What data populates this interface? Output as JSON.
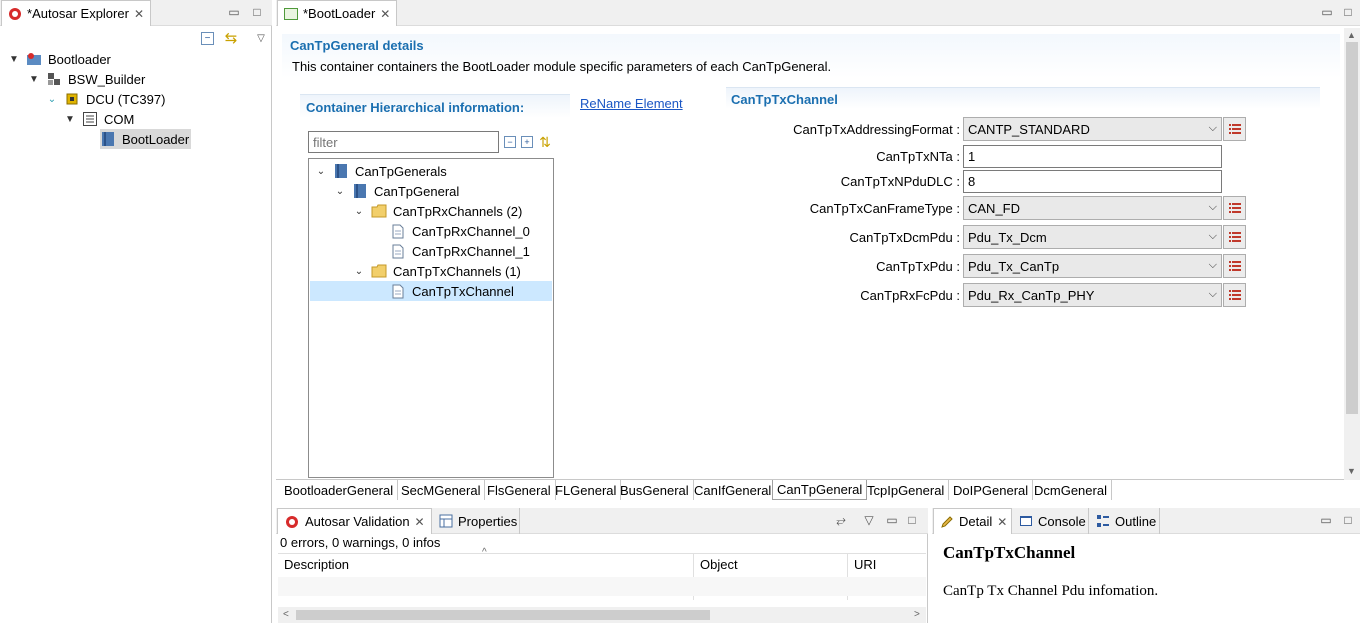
{
  "explorer": {
    "tab_title": "*Autosar Explorer",
    "tree": [
      {
        "label": "Bootloader",
        "icon": "autosar-project-icon"
      },
      {
        "label": "BSW_Builder",
        "icon": "builder-icon"
      },
      {
        "label": "DCU (TC397)",
        "icon": "chip-icon"
      },
      {
        "label": "COM",
        "icon": "list-icon"
      },
      {
        "label": "BootLoader",
        "icon": "module-icon"
      }
    ]
  },
  "editor": {
    "tab_title": "*BootLoader",
    "details_title": "CanTpGeneral details",
    "details_desc": "This container containers the BootLoader module specific parameters of each CanTpGeneral.",
    "hier_title": "Container Hierarchical information:",
    "rename_link": "ReName Element",
    "filter_placeholder": "filter",
    "tree": [
      {
        "label": "CanTpGenerals"
      },
      {
        "label": "CanTpGeneral"
      },
      {
        "label": "CanTpRxChannels (2)"
      },
      {
        "label": "CanTpRxChannel_0"
      },
      {
        "label": "CanTpRxChannel_1"
      },
      {
        "label": "CanTpTxChannels (1)"
      },
      {
        "label": "CanTpTxChannel"
      }
    ],
    "form_title": "CanTpTxChannel",
    "fields": [
      {
        "label": "CanTpTxAddressingFormat :",
        "value": "CANTP_STANDARD",
        "kind": "combo"
      },
      {
        "label": "CanTpTxNTa :",
        "value": "1",
        "kind": "text"
      },
      {
        "label": "CanTpTxNPduDLC :",
        "value": "8",
        "kind": "text"
      },
      {
        "label": "CanTpTxCanFrameType :",
        "value": "CAN_FD",
        "kind": "combo"
      },
      {
        "label": "CanTpTxDcmPdu :",
        "value": "Pdu_Tx_Dcm",
        "kind": "combo"
      },
      {
        "label": "CanTpTxPdu :",
        "value": "Pdu_Tx_CanTp",
        "kind": "combo"
      },
      {
        "label": "CanTpRxFcPdu :",
        "value": "Pdu_Rx_CanTp_PHY",
        "kind": "combo"
      }
    ],
    "bottom_tabs": [
      "BootloaderGeneral",
      "SecMGeneral",
      "FlsGeneral",
      "FLGeneral",
      "BusGeneral",
      "CanIfGeneral",
      "CanTpGeneral",
      "TcpIpGeneral",
      "DoIPGeneral",
      "DcmGeneral"
    ],
    "active_bottom_tab": "CanTpGeneral"
  },
  "validation": {
    "tab_title": "Autosar Validation",
    "properties_tab": "Properties",
    "summary": "0 errors, 0 warnings, 0 infos",
    "columns": [
      "Description",
      "Object",
      "URI"
    ]
  },
  "detail": {
    "tabs": [
      "Detail",
      "Console",
      "Outline"
    ],
    "heading": "CanTpTxChannel",
    "text": "CanTp Tx Channel Pdu infomation."
  },
  "colors": {
    "accent": "#1b6fb0",
    "selection": "#cce8ff",
    "link": "#1a56c4"
  }
}
